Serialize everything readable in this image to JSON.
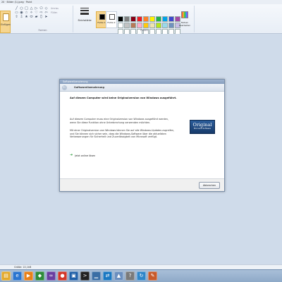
{
  "window": {
    "title": "20 · Bilder (1).jpeg · Paint"
  },
  "ribbon": {
    "paste_label": "Einfügen",
    "shape_glyphs": [
      "╱",
      "○",
      "□",
      "△",
      "▷",
      "⬠",
      "◇",
      "▭",
      "◉",
      "☆",
      "✧",
      "♡",
      "⇨",
      "⇦",
      "⇧",
      "⇩",
      "★",
      "⬭",
      "▰",
      "⬯",
      "➤"
    ],
    "shape_outline_label": "Umriss",
    "shape_fill_label": "Füllen",
    "shapes_group_label": "Formen",
    "line_width_label": "Strichstärke",
    "color1_label": "Farbe 1",
    "color2_label": "Farbe 2",
    "edit_colors_label": "Farben bearbeiten",
    "colors_group_label": "Farben",
    "color1_value": "#000000",
    "color2_value": "#ffffff",
    "palette": [
      "#000000",
      "#7f7f7f",
      "#880015",
      "#ed1c24",
      "#ff7f27",
      "#fff200",
      "#22b14c",
      "#00a2e8",
      "#3f48cc",
      "#a349a4",
      "#ffffff",
      "#c3c3c3",
      "#b97a57",
      "#ffaec9",
      "#ffc90e",
      "#efe4b0",
      "#b5e61d",
      "#99d9ea",
      "#7092be",
      "#c8bfe7",
      "#ffffff",
      "#ffffff",
      "#ffffff",
      "#ffffff",
      "#ffffff",
      "#ffffff",
      "#ffffff",
      "#ffffff",
      "#ffffff",
      "#ffffff"
    ]
  },
  "dialog": {
    "title": "Softwarelizenzierung",
    "heading": "Softwarelizenzierung",
    "message_bold": "Auf diesem Computer wird keine Originalversion von Windows ausgeführt.",
    "paragraph1": "Auf diesem Computer muss eine Originalversion von Windows ausgeführt werden, wenn Sie diese Funktion ohne Unterbrechung verwenden möchten.",
    "paragraph2": "Mit einer Originalversion von Windows können Sie auf alle Windows-Updates zugreifen, und Sie können sich sicher sein, dass die Windows-Software über die aktuellsten Verbesserungen für Sicherheit und Zuverlässigkeit von Microsoft verfügt.",
    "logo_big": "Original",
    "logo_small": "Microsoft Software",
    "action_label": "Jetzt online lösen",
    "privacy_link": "Datenschutzbestimmungen online anzeigen",
    "cancel_label": "Abbrechen"
  },
  "statusbar": {
    "size_text": "Größe: 22,1kB"
  },
  "taskbar": {
    "icons": [
      {
        "name": "explorer-icon",
        "glyph": "▤",
        "color": "#e3a92b"
      },
      {
        "name": "ie-icon",
        "glyph": "e",
        "color": "#2a75d0"
      },
      {
        "name": "mediaplayer-icon",
        "glyph": "▶",
        "color": "#e8801a"
      },
      {
        "name": "app-green-icon",
        "glyph": "◆",
        "color": "#2e8b3a"
      },
      {
        "name": "visual-studio-icon",
        "glyph": "∞",
        "color": "#6a3ea1"
      },
      {
        "name": "chrome-icon",
        "glyph": "●",
        "color": "#d2382b"
      },
      {
        "name": "virtualbox-icon",
        "glyph": "▣",
        "color": "#1f5fa8"
      },
      {
        "name": "cmd-icon",
        "glyph": ">",
        "color": "#222222"
      },
      {
        "name": "performance-icon",
        "glyph": "▁",
        "color": "#3a6ea5"
      },
      {
        "name": "teamviewer-icon",
        "glyph": "⇄",
        "color": "#1a78c2"
      },
      {
        "name": "photo-viewer-icon",
        "glyph": "▲",
        "color": "#6b8fbf"
      },
      {
        "name": "unknown-app-icon",
        "glyph": "?",
        "color": "#7a7a7a"
      },
      {
        "name": "refresh-icon",
        "glyph": "↻",
        "color": "#2f86c9"
      },
      {
        "name": "paint-icon",
        "glyph": "✎",
        "color": "#c85a2a"
      }
    ]
  }
}
